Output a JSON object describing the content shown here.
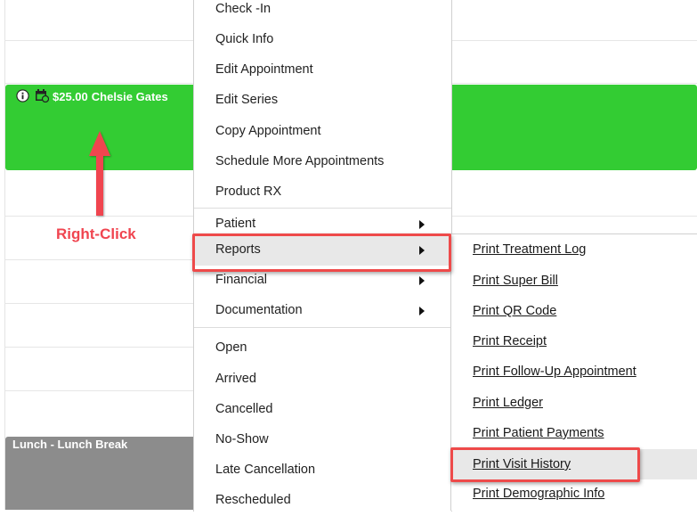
{
  "appointment": {
    "price": "$25.00",
    "patient": "Chelsie Gates",
    "color": "#33cc33",
    "icons": [
      "info-icon",
      "calendar-sync-icon"
    ]
  },
  "lunch": {
    "label": "Lunch - Lunch Break",
    "color": "#8c8c8c"
  },
  "annotation": {
    "text": "Right-Click",
    "color": "#f04550"
  },
  "context_menu": {
    "items": [
      {
        "label": "Check -In"
      },
      {
        "label": "Quick Info"
      },
      {
        "label": "Edit Appointment"
      },
      {
        "label": "Edit Series"
      },
      {
        "label": "Copy Appointment"
      },
      {
        "label": "Schedule More Appointments"
      },
      {
        "label": "Product RX"
      },
      {
        "label": "Patient",
        "submenu": true
      },
      {
        "label": "Reports",
        "submenu": true,
        "highlighted": true
      },
      {
        "label": "Financial",
        "submenu": true
      },
      {
        "label": "Documentation",
        "submenu": true
      },
      {
        "label": "Open"
      },
      {
        "label": "Arrived"
      },
      {
        "label": "Cancelled"
      },
      {
        "label": "No-Show"
      },
      {
        "label": "Late Cancellation"
      },
      {
        "label": "Rescheduled"
      }
    ]
  },
  "reports_submenu": {
    "items": [
      {
        "label": "Print Treatment Log"
      },
      {
        "label": "Print Super Bill"
      },
      {
        "label": "Print QR Code"
      },
      {
        "label": "Print Receipt"
      },
      {
        "label": "Print Follow-Up Appointment"
      },
      {
        "label": "Print Ledger"
      },
      {
        "label": "Print Patient Payments"
      },
      {
        "label": "Print Visit History",
        "highlighted": true
      },
      {
        "label": "Print Demographic Info"
      }
    ]
  },
  "highlight_color": "#ee4a4a"
}
